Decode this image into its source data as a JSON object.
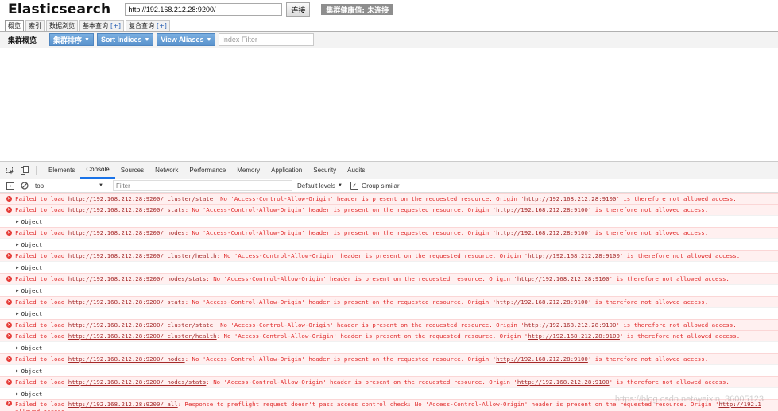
{
  "app": {
    "title": "Elasticsearch",
    "url_value": "http://192.168.212.28:9200/",
    "connect_label": "连接",
    "health_label": "集群健康值: 未连接",
    "tabs": [
      {
        "label": "概览",
        "plus": ""
      },
      {
        "label": "索引",
        "plus": ""
      },
      {
        "label": "数据浏览",
        "plus": ""
      },
      {
        "label": "基本查询",
        "plus": "[+]"
      },
      {
        "label": "复合查询",
        "plus": "[+]"
      }
    ],
    "toolbar": {
      "title": "集群概览",
      "cluster_sort": "集群排序",
      "sort_indices": "Sort Indices",
      "view_aliases": "View Aliases",
      "index_filter_placeholder": "Index Filter"
    }
  },
  "devtools": {
    "tabs": [
      "Elements",
      "Console",
      "Sources",
      "Network",
      "Performance",
      "Memory",
      "Application",
      "Security",
      "Audits"
    ],
    "active_tab": "Console",
    "context": "top",
    "filter_placeholder": "Filter",
    "levels": "Default levels",
    "group_similar": "Group similar",
    "entries": [
      {
        "kind": "error",
        "pre": "Failed to load ",
        "url": "http://192.168.212.28:9200/_cluster/state",
        "mid": ": No 'Access-Control-Allow-Origin' header is present on the requested resource. Origin '",
        "origin": "http://192.168.212.28:9100",
        "post": "' is therefore not allowed access."
      },
      {
        "kind": "error",
        "pre": "Failed to load ",
        "url": "http://192.168.212.28:9200/_stats",
        "mid": ": No 'Access-Control-Allow-Origin' header is present on the requested resource. Origin '",
        "origin": "http://192.168.212.28:9100",
        "post": "' is therefore not allowed access."
      },
      {
        "kind": "object",
        "text": "Object"
      },
      {
        "kind": "error",
        "pre": "Failed to load ",
        "url": "http://192.168.212.28:9200/_nodes",
        "mid": ": No 'Access-Control-Allow-Origin' header is present on the requested resource. Origin '",
        "origin": "http://192.168.212.28:9100",
        "post": "' is therefore not allowed access."
      },
      {
        "kind": "object",
        "text": "Object"
      },
      {
        "kind": "error",
        "pre": "Failed to load ",
        "url": "http://192.168.212.28:9200/_cluster/health",
        "mid": ": No 'Access-Control-Allow-Origin' header is present on the requested resource. Origin '",
        "origin": "http://192.168.212.28:9100",
        "post": "' is therefore not allowed access."
      },
      {
        "kind": "object",
        "text": "Object"
      },
      {
        "kind": "error",
        "pre": "Failed to load ",
        "url": "http://192.168.212.28:9200/_nodes/stats",
        "mid": ": No 'Access-Control-Allow-Origin' header is present on the requested resource. Origin '",
        "origin": "http://192.168.212.28:9100",
        "post": "' is therefore not allowed access."
      },
      {
        "kind": "object",
        "text": "Object"
      },
      {
        "kind": "error",
        "pre": "Failed to load ",
        "url": "http://192.168.212.28:9200/_stats",
        "mid": ": No 'Access-Control-Allow-Origin' header is present on the requested resource. Origin '",
        "origin": "http://192.168.212.28:9100",
        "post": "' is therefore not allowed access."
      },
      {
        "kind": "object",
        "text": "Object"
      },
      {
        "kind": "error",
        "pre": "Failed to load ",
        "url": "http://192.168.212.28:9200/_cluster/state",
        "mid": ": No 'Access-Control-Allow-Origin' header is present on the requested resource. Origin '",
        "origin": "http://192.168.212.28:9100",
        "post": "' is therefore not allowed access."
      },
      {
        "kind": "error",
        "pre": "Failed to load ",
        "url": "http://192.168.212.28:9200/_cluster/health",
        "mid": ": No 'Access-Control-Allow-Origin' header is present on the requested resource. Origin '",
        "origin": "http://192.168.212.28:9100",
        "post": "' is therefore not allowed access."
      },
      {
        "kind": "object",
        "text": "Object"
      },
      {
        "kind": "error",
        "pre": "Failed to load ",
        "url": "http://192.168.212.28:9200/_nodes",
        "mid": ": No 'Access-Control-Allow-Origin' header is present on the requested resource. Origin '",
        "origin": "http://192.168.212.28:9100",
        "post": "' is therefore not allowed access."
      },
      {
        "kind": "object",
        "text": "Object"
      },
      {
        "kind": "error",
        "pre": "Failed to load ",
        "url": "http://192.168.212.28:9200/_nodes/stats",
        "mid": ": No 'Access-Control-Allow-Origin' header is present on the requested resource. Origin '",
        "origin": "http://192.168.212.28:9100",
        "post": "' is therefore not allowed access."
      },
      {
        "kind": "object",
        "text": "Object"
      },
      {
        "kind": "error_tall",
        "pre": "Failed to load ",
        "url": "http://192.168.212.28:9200/_all",
        "mid": ": Response to preflight request doesn't pass access control check: No 'Access-Control-Allow-Origin' header is present on the requested resource. Origin '",
        "origin": "http://192.1",
        "post": " allowed access."
      }
    ]
  },
  "watermark": "https://blog.csdn.net/weixin_36005123",
  "colors": {
    "error_text": "#e02b2b",
    "error_bg": "#fff0f0",
    "button_blue": "#5b93cd",
    "active_tab": "#1a73e8"
  }
}
